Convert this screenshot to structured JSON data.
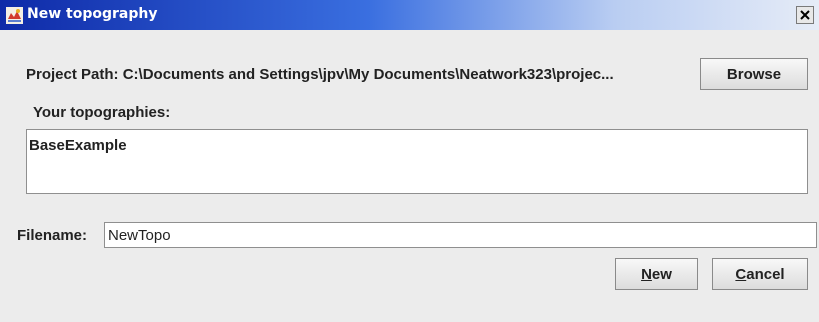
{
  "window": {
    "title": "New topography",
    "close_symbol": "×"
  },
  "project": {
    "label": "Project Path:",
    "path": "C:\\Documents and Settings\\jpv\\My Documents\\Neatwork323\\projec...",
    "browse_label": "Browse"
  },
  "topographies": {
    "label": "Your topographies:",
    "items": [
      "BaseExample"
    ]
  },
  "filename": {
    "label": "Filename:",
    "value": "NewTopo"
  },
  "buttons": {
    "new_mnemonic": "N",
    "new_rest": "ew",
    "cancel_mnemonic": "C",
    "cancel_rest": "ancel"
  },
  "icons": {
    "title": "app-logo-icon",
    "close": "close-icon"
  },
  "colors": {
    "titlebar_start": "#0e2aa8",
    "titlebar_end": "#e6ecf7",
    "background": "#ececec"
  }
}
